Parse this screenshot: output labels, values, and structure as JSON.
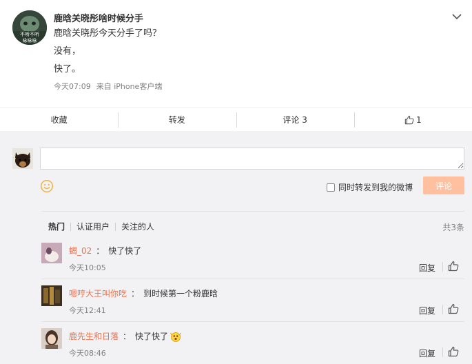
{
  "post": {
    "author": "鹿晗关晓彤啥时候分手",
    "lines": [
      "鹿晗关晓彤今天分手了吗？",
      "没有，",
      "快了。"
    ],
    "time": "今天07:09",
    "source": "来自 iPhone客户端",
    "avatar_caption_1": "不听不听",
    "avatar_caption_2": "咏咏咏"
  },
  "actions": {
    "favorite": "收藏",
    "forward": "转发",
    "comment": "评论 3",
    "like_count": "1"
  },
  "composer": {
    "placeholder": "",
    "forward_label": "同时转发到我的微博",
    "submit_label": "评论"
  },
  "filters": {
    "tabs": [
      "热门",
      "认证用户",
      "关注的人"
    ],
    "total": "共3条"
  },
  "comments": [
    {
      "user": "蝎_02",
      "text": "快了快了",
      "time": "今天10:05",
      "reply": "回复"
    },
    {
      "user": "嗯哼大王叫你吃",
      "text": "到时候第一个粉鹿晗",
      "time": "今天12:41",
      "reply": "回复"
    },
    {
      "user": "鹿先生和日落",
      "text": "快了快了",
      "time": "今天08:46",
      "reply": "回复"
    }
  ],
  "colors": {
    "username": "#eb7350",
    "submit_button": "#ffc09f",
    "emoji_icon": "#f0b23a"
  }
}
